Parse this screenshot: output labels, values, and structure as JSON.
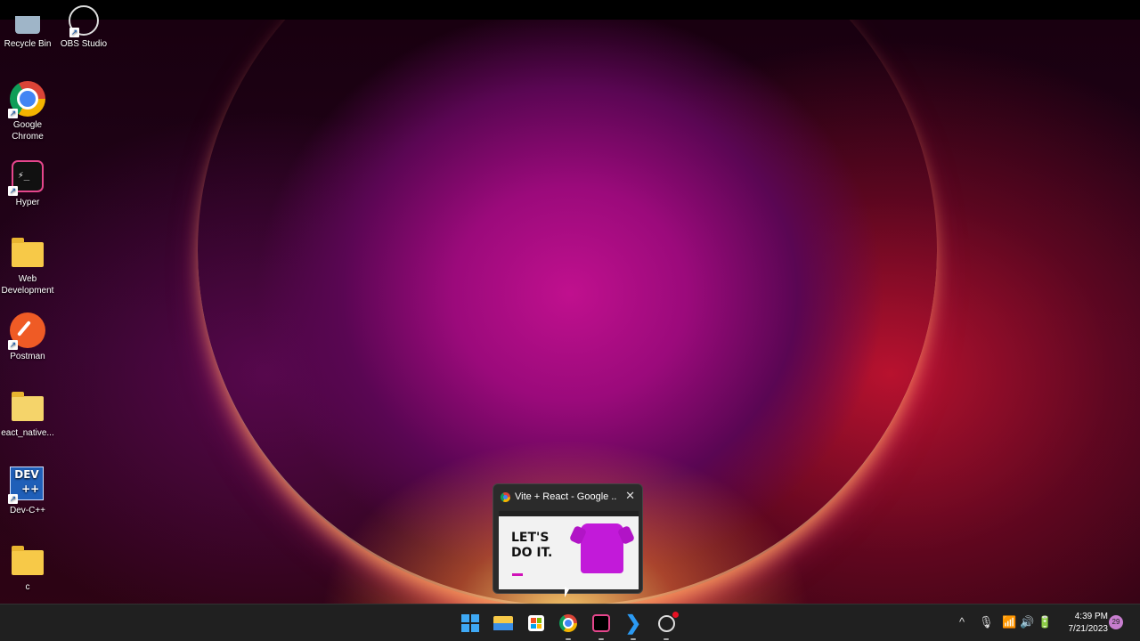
{
  "desktop": {
    "icons": [
      {
        "label": "Recycle Bin",
        "icon": "recycle-bin-icon"
      },
      {
        "label": "OBS Studio",
        "icon": "obs-studio-icon"
      },
      {
        "label": "Google Chrome",
        "icon": "google-chrome-icon"
      },
      {
        "label": "Hyper",
        "icon": "hyper-terminal-icon"
      },
      {
        "label": "Web Development",
        "icon": "folder-icon"
      },
      {
        "label": "Postman",
        "icon": "postman-icon"
      },
      {
        "label": "eact_native...",
        "icon": "folder-icon"
      },
      {
        "label": "Dev-C++",
        "icon": "devcpp-icon"
      },
      {
        "label": "c",
        "icon": "folder-icon"
      }
    ]
  },
  "preview": {
    "title": "Vite + React - Google ...",
    "close": "✕",
    "thumbnail_headline": "LET'S DO IT."
  },
  "taskbar": {
    "apps": [
      "start-icon",
      "file-explorer-icon",
      "microsoft-store-icon",
      "google-chrome-icon",
      "hyper-terminal-icon",
      "vscode-icon",
      "obs-studio-icon"
    ],
    "tray": {
      "chevron": "^",
      "time": "4:39 PM",
      "date": "7/21/2023",
      "notifications": "29"
    }
  },
  "colors": {
    "accent": "#c21ad9",
    "taskbar": "#202020"
  }
}
